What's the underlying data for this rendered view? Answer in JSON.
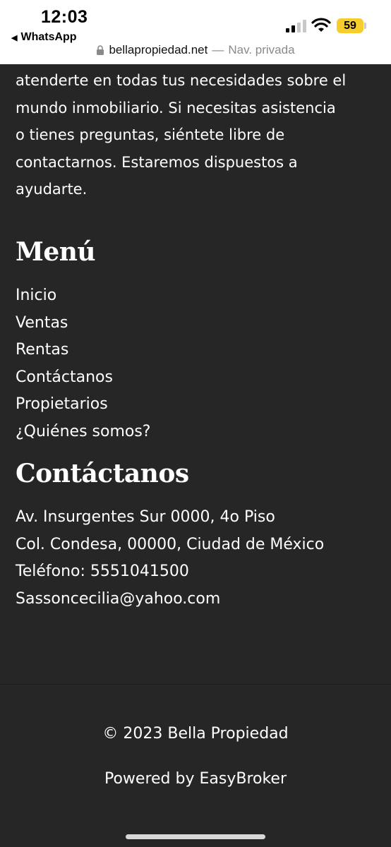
{
  "status_bar": {
    "time": "12:03",
    "back_app": "WhatsApp",
    "battery": "59"
  },
  "url_bar": {
    "domain": "bellapropiedad.net",
    "separator": "—",
    "mode": "Nav. privada"
  },
  "intro_text": "atenderte en todas tus necesidades sobre el\nmundo inmobiliario. Si necesitas asistencia\no tienes preguntas, siéntete libre de\ncontactarnos. Estaremos dispuestos a\nayudarte.",
  "menu": {
    "title": "Menú",
    "items": [
      {
        "label": "Inicio"
      },
      {
        "label": "Ventas"
      },
      {
        "label": "Rentas"
      },
      {
        "label": "Contáctanos"
      },
      {
        "label": "Propietarios"
      },
      {
        "label": "¿Quiénes somos?"
      }
    ]
  },
  "contact": {
    "title": "Contáctanos",
    "address_line1": "Av. Insurgentes Sur 0000, 4o Piso",
    "address_line2": "Col. Condesa, 00000, Ciudad de México",
    "phone": "Teléfono: 5551041500",
    "email": "Sassoncecilia@yahoo.com"
  },
  "footer": {
    "copyright": "© 2023 Bella Propiedad",
    "powered": "Powered by EasyBroker"
  },
  "colors": {
    "background": "#262626",
    "text": "#ffffff",
    "battery": "#f6cd2b"
  }
}
